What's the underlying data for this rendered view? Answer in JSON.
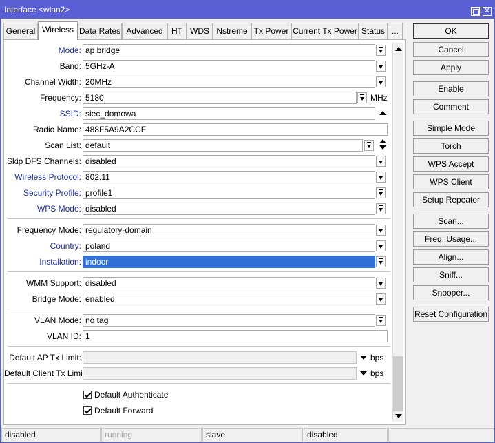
{
  "window": {
    "title": "Interface <wlan2>"
  },
  "tabs": [
    "General",
    "Wireless",
    "Data Rates",
    "Advanced",
    "HT",
    "WDS",
    "Nstreme",
    "Tx Power",
    "Current Tx Power",
    "Status",
    "..."
  ],
  "active_tab": "Wireless",
  "fields": {
    "mode": {
      "label": "Mode:",
      "value": "ap bridge"
    },
    "band": {
      "label": "Band:",
      "value": "5GHz-A"
    },
    "channel_width": {
      "label": "Channel Width:",
      "value": "20MHz"
    },
    "frequency": {
      "label": "Frequency:",
      "value": "5180",
      "unit": "MHz"
    },
    "ssid": {
      "label": "SSID:",
      "value": "siec_domowa"
    },
    "radio_name": {
      "label": "Radio Name:",
      "value": "488F5A9A2CCF"
    },
    "scan_list": {
      "label": "Scan List:",
      "value": "default"
    },
    "skip_dfs": {
      "label": "Skip DFS Channels:",
      "value": "disabled"
    },
    "wireless_protocol": {
      "label": "Wireless Protocol:",
      "value": "802.11"
    },
    "security_profile": {
      "label": "Security Profile:",
      "value": "profile1"
    },
    "wps_mode": {
      "label": "WPS Mode:",
      "value": "disabled"
    },
    "frequency_mode": {
      "label": "Frequency Mode:",
      "value": "regulatory-domain"
    },
    "country": {
      "label": "Country:",
      "value": "poland"
    },
    "installation": {
      "label": "Installation:",
      "value": "indoor"
    },
    "wmm_support": {
      "label": "WMM Support:",
      "value": "disabled"
    },
    "bridge_mode": {
      "label": "Bridge Mode:",
      "value": "enabled"
    },
    "vlan_mode": {
      "label": "VLAN Mode:",
      "value": "no tag"
    },
    "vlan_id": {
      "label": "VLAN ID:",
      "value": "1"
    },
    "default_ap_tx_limit": {
      "label": "Default AP Tx Limit:",
      "value": "",
      "unit": "bps"
    },
    "default_client_tx_limit": {
      "label": "Default Client Tx Limit:",
      "value": "",
      "unit": "bps"
    }
  },
  "checkboxes": {
    "default_authenticate": {
      "label": "Default Authenticate",
      "checked": true
    },
    "default_forward": {
      "label": "Default Forward",
      "checked": true
    }
  },
  "buttons": {
    "ok": "OK",
    "cancel": "Cancel",
    "apply": "Apply",
    "enable": "Enable",
    "comment": "Comment",
    "simple_mode": "Simple Mode",
    "torch": "Torch",
    "wps_accept": "WPS Accept",
    "wps_client": "WPS Client",
    "setup_repeater": "Setup Repeater",
    "scan": "Scan...",
    "freq_usage": "Freq. Usage...",
    "align": "Align...",
    "sniff": "Sniff...",
    "snooper": "Snooper...",
    "reset_configuration": "Reset Configuration"
  },
  "status_bar": [
    "disabled",
    "running",
    "slave",
    "disabled"
  ],
  "colors": {
    "titlebar": "#5b5fd6",
    "label_link": "#1c2fa8",
    "selection": "#2f6fd6"
  }
}
